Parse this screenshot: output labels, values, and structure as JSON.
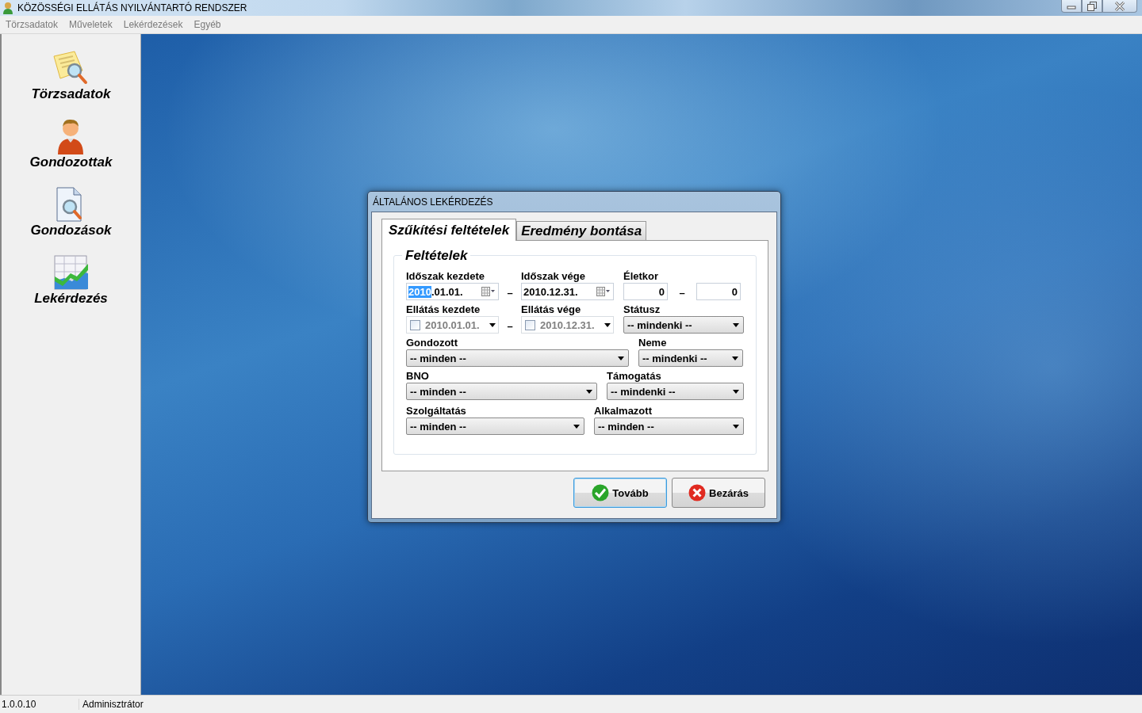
{
  "window": {
    "title": "KÖZÖSSÉGI ELLÁTÁS NYILVÁNTARTÓ RENDSZER"
  },
  "menu": [
    "Törzsadatok",
    "Műveletek",
    "Lekérdezések",
    "Egyéb"
  ],
  "sidebar": {
    "items": [
      {
        "label": "Törzsadatok",
        "kind": "note"
      },
      {
        "label": "Gondozottak",
        "kind": "person"
      },
      {
        "label": "Gondozások",
        "kind": "document"
      },
      {
        "label": "Lekérdezés",
        "kind": "chart"
      }
    ]
  },
  "dialog": {
    "title": "ÁLTALÁNOS LEKÉRDEZÉS",
    "tabs": [
      {
        "label": "Szűkítési feltételek",
        "selected": true
      },
      {
        "label": "Eredmény bontása",
        "selected": false
      }
    ],
    "group_title": "Feltételek",
    "rows": [
      [
        {
          "kind": "date",
          "label": "Időszak kezdete",
          "selected_part": "2010",
          "value": ".01.01."
        },
        {
          "kind": "dash",
          "text": "–"
        },
        {
          "kind": "date",
          "label": "Időszak vége",
          "value": "2010.12.31."
        },
        {
          "kind": "number",
          "label": "Életkor",
          "value": "0"
        },
        {
          "kind": "dash",
          "text": "–"
        },
        {
          "kind": "number",
          "value": "0"
        }
      ],
      [
        {
          "kind": "checkdate",
          "label": "Ellátás kezdete",
          "value": "2010.01.01.",
          "checked": false,
          "disabled": true
        },
        {
          "kind": "dash",
          "text": "–"
        },
        {
          "kind": "checkdate",
          "label": "Ellátás vége",
          "value": "2010.12.31.",
          "checked": false,
          "disabled": true
        },
        {
          "kind": "select",
          "label": "Státusz",
          "value": "-- mindenki --"
        }
      ],
      [
        {
          "kind": "select",
          "label": "Gondozott",
          "value": "-- minden --"
        },
        {
          "kind": "select",
          "label": "Neme",
          "value": "-- mindenki --"
        }
      ],
      [
        {
          "kind": "select",
          "label": "BNO",
          "value": "-- minden --"
        },
        {
          "kind": "select",
          "label": "Támogatás",
          "value": "-- mindenki --"
        }
      ],
      [
        {
          "kind": "select",
          "label": "Szolgáltatás",
          "value": "-- minden --"
        },
        {
          "kind": "select",
          "label": "Alkalmazott",
          "value": "-- minden --"
        }
      ]
    ],
    "buttons": [
      {
        "label": "Tovább",
        "kind": "ok",
        "focused": true
      },
      {
        "label": "Bezárás",
        "kind": "cancel",
        "focused": false
      }
    ]
  },
  "status_bar": [
    "1.0.0.10",
    "Adminisztrátor"
  ]
}
